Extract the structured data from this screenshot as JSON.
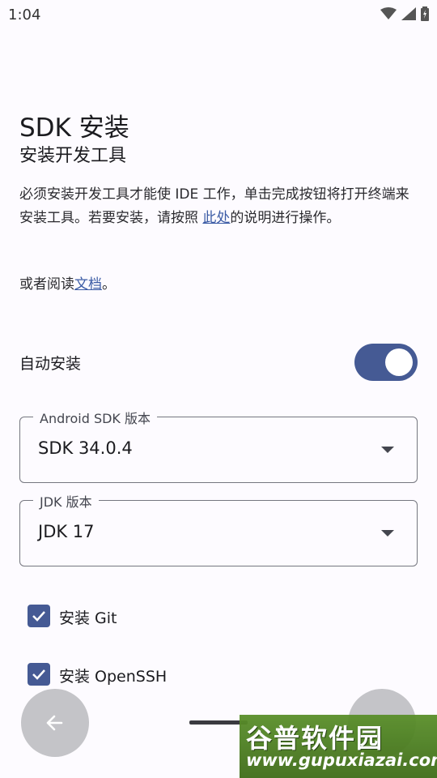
{
  "status_bar": {
    "time": "1:04",
    "icons": [
      "wifi-icon",
      "cell-signal-icon",
      "battery-icon"
    ]
  },
  "header": {
    "title": "SDK 安装",
    "subtitle": "安装开发工具"
  },
  "description": {
    "text_before_link": "必须安装开发工具才能使 IDE 工作，单击完成按钮将打开终端来安装工具。若要安装，请按照 ",
    "link_text": "此处",
    "text_after_link": "的说明进行操作。"
  },
  "alt_docs": {
    "prefix": "或者阅读",
    "link_text": "文档",
    "suffix": "。"
  },
  "auto_install": {
    "label": "自动安装",
    "enabled": true
  },
  "android_sdk": {
    "label": "Android SDK 版本",
    "value": "SDK 34.0.4"
  },
  "jdk": {
    "label": "JDK 版本",
    "value": "JDK 17"
  },
  "options": [
    {
      "label": "安装 Git",
      "checked": true
    },
    {
      "label": "安装 OpenSSH",
      "checked": true
    }
  ],
  "navigation": {
    "back_icon": "arrow-left-icon",
    "next_icon": "arrow-right-icon"
  },
  "watermark": {
    "title": "谷普软件园",
    "url": "www.gupuxiazai.com"
  },
  "colors": {
    "accent": "#455a94",
    "link": "#3b5ba5",
    "background": "#fdfbff"
  }
}
